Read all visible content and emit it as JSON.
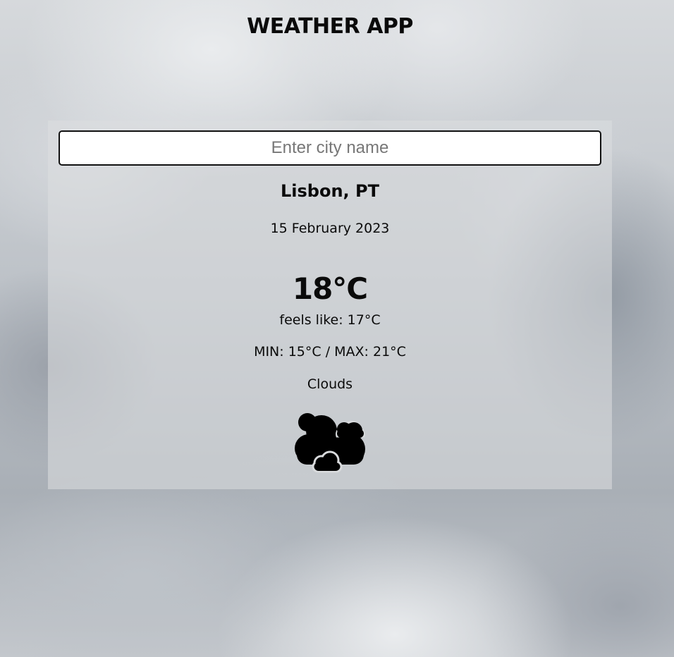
{
  "app": {
    "title": "WEATHER APP"
  },
  "search": {
    "placeholder": "Enter city name",
    "value": ""
  },
  "weather": {
    "location": "Lisbon, PT",
    "date": "15 February 2023",
    "temperature": "18°C",
    "feels_like": "feels like: 17°C",
    "min_max": "MIN: 15°C / MAX: 21°C",
    "description": "Clouds",
    "icon": "clouds-icon"
  },
  "colors": {
    "text": "#0a0a0a",
    "input_border": "#111111"
  }
}
